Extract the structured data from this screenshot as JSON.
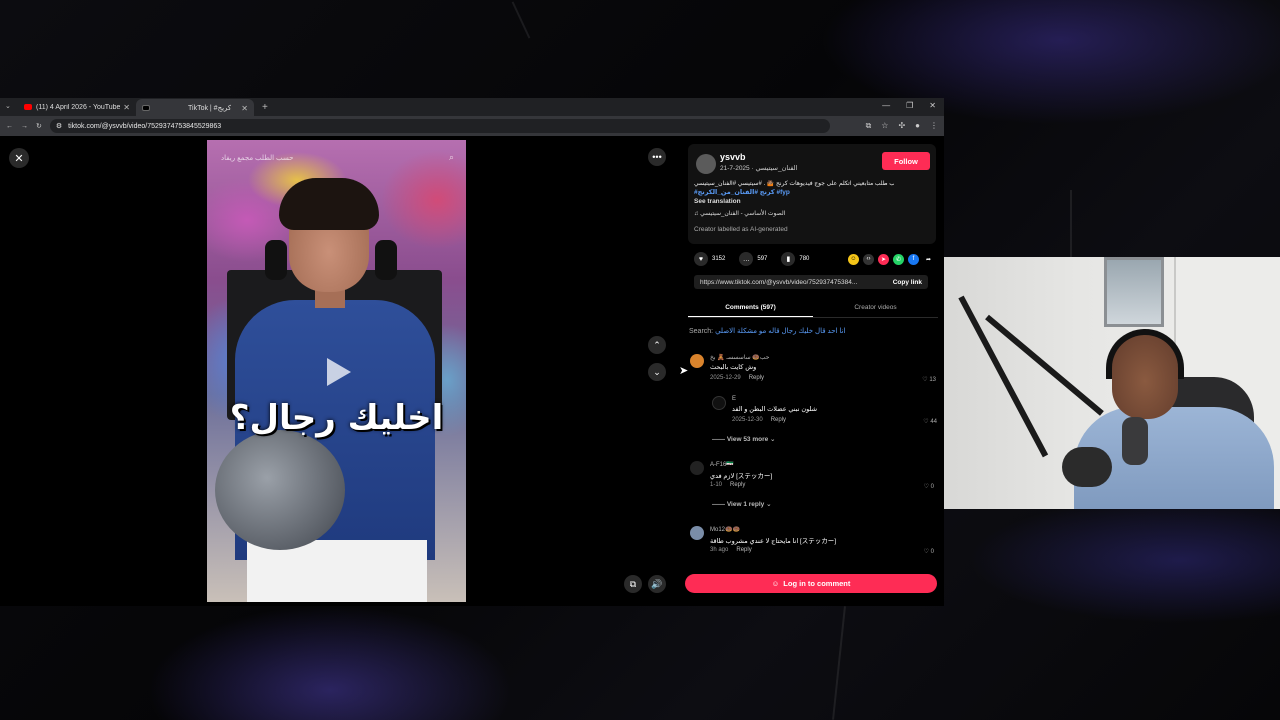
{
  "browser": {
    "tabs": [
      {
        "title": "(11) 4 April 2026 - YouTube",
        "favicon_color": "#ff0000"
      },
      {
        "title": "TikTok | #كريج",
        "favicon_color": "#000000"
      }
    ],
    "url": "tiktok.com/@ysvvb/video/7529374753845529863"
  },
  "video": {
    "caption": "اخليك رجال؟",
    "top_text": "حسب الطلب مجمع ريفاد"
  },
  "post": {
    "username": "ysvvb",
    "display_line": "الفنان_سيتيسي · 2025-7-21",
    "follow_label": "Follow",
    "description": "حسب طلب متابعيني اتكلم على جوج فيديوهات كرنج 🤷🏽 . #سيتيسي #الفنان_سيتيسي 🤷🏽",
    "hashtags": "#كرنج #الفنان_من_الكرنج #fyp",
    "see_translation": "See translation",
    "music": "الصوت الأساسي - الفنان_سيتيسي",
    "ai_label": "Creator labelled as AI-generated"
  },
  "actions": {
    "likes": "3152",
    "comments": "597",
    "saves": "780"
  },
  "share_link": {
    "url": "https://www.tiktok.com/@ysvvb/video/752937475384...",
    "copy_label": "Copy link"
  },
  "tabs": {
    "comments": "Comments (597)",
    "creator_videos": "Creator videos"
  },
  "search": {
    "label": "Search:",
    "query": "انا احد قال خليك رجال قاله مو مشكلة الاصلي"
  },
  "comments": [
    {
      "name": "حب🍩 ساسسسـ 🧸 بخ",
      "text": "وش كايت بالبحث",
      "date": "2025-12-29",
      "reply": "Reply",
      "likes": "13",
      "avatar_color": "#d9832c"
    },
    {
      "name": "E",
      "text": "شلون نبني عضلات البطن و الفد",
      "date": "2025-12-30",
      "reply": "Reply",
      "likes": "44",
      "avatar_color": "#111111"
    },
    {
      "name": "A-F16🇸🇾",
      "text": "لازم فدي [ステッカー]",
      "date": "1-10",
      "reply": "Reply",
      "likes": "0",
      "avatar_color": "#222222"
    },
    {
      "name": "Mo12🍩🍩",
      "text": "انا مايحتاج لا عندي مشروب طاقة [ステッカー]",
      "date": "3h ago",
      "reply": "Reply",
      "likes": "0",
      "avatar_color": "#7a8da8"
    }
  ],
  "view_more": {
    "first": "View 53 more",
    "second": "View 1 reply"
  },
  "login_label": "Log in to comment",
  "colors": {
    "accent": "#fe2c55",
    "hashtag": "#5a9cf8"
  }
}
